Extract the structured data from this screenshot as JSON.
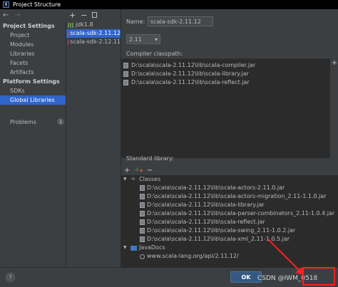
{
  "window": {
    "title": "Project Structure"
  },
  "nav": {
    "back": "←",
    "forward": "→"
  },
  "sidebar": {
    "project_settings_heading": "Project Settings",
    "project_items": [
      "Project",
      "Modules",
      "Libraries",
      "Facets",
      "Artifacts"
    ],
    "platform_settings_heading": "Platform Settings",
    "platform_items": [
      "SDKs",
      "Global Libraries"
    ],
    "selected": "Global Libraries",
    "problems_label": "Problems",
    "problems_count": "1"
  },
  "libraries_toolbar": {
    "add": "+",
    "remove": "−"
  },
  "libraries": [
    {
      "name": "jdk1.8",
      "icon": "jdk-library-icon"
    },
    {
      "name": "scala-sdk-2.11.12",
      "icon": "scala-library-icon",
      "selected": true
    },
    {
      "name": "scala-sdk-2.12.11",
      "icon": "scala-library-icon"
    }
  ],
  "details": {
    "name_label": "Name:",
    "name_value": "scala-sdk-2.11.12",
    "version_value": "2.11",
    "compiler_classpath_label": "Compiler classpath:",
    "compiler_classpath": [
      "D:\\scala\\scala-2.11.12\\lib\\scala-compiler.jar",
      "D:\\scala\\scala-2.11.12\\lib\\scala-library.jar",
      "D:\\scala\\scala-2.11.12\\lib\\scala-reflect.jar"
    ],
    "classpath_add": "+",
    "standard_library_label": "Standard library:",
    "std_toolbar": {
      "add": "+",
      "remove": "−"
    },
    "classes_label": "Classes",
    "classes": [
      "D:\\scala\\scala-2.11.12\\lib\\scala-actors-2.11.0.jar",
      "D:\\scala\\scala-2.11.12\\lib\\scala-actors-migration_2.11-1.1.0.jar",
      "D:\\scala\\scala-2.11.12\\lib\\scala-library.jar",
      "D:\\scala\\scala-2.11.12\\lib\\scala-parser-combinators_2.11-1.0.4.jar",
      "D:\\scala\\scala-2.11.12\\lib\\scala-reflect.jar",
      "D:\\scala\\scala-2.11.12\\lib\\scala-swing_2.11-1.0.2.jar",
      "D:\\scala\\scala-2.11.12\\lib\\scala-xml_2.11-1.0.5.jar"
    ],
    "javadocs_label": "JavaDocs",
    "javadocs": [
      "www.scala-lang.org/api/2.11.12/"
    ]
  },
  "footer": {
    "help": "?",
    "ok": "OK",
    "watermark": "CSDN @IWM_0518"
  },
  "colors": {
    "background": "#3c3f41",
    "list_background": "#2b2b2b",
    "selection": "#2f65ca",
    "ok_button": "#365880",
    "annotation": "#ff2020"
  }
}
